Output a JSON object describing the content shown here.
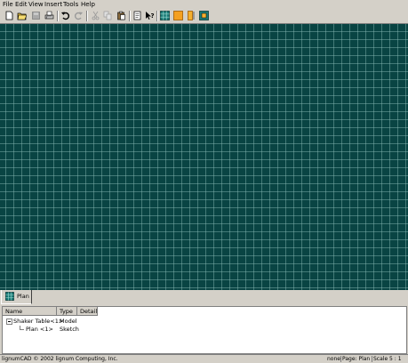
{
  "menubar": {
    "items": [
      "File",
      "Edit",
      "View",
      "Insert",
      "Tools",
      "Help"
    ]
  },
  "toolbar": {
    "icons": [
      "new-file-icon",
      "open-folder-icon",
      "save-icon",
      "print-icon",
      "undo-icon",
      "redo-icon",
      "cut-icon",
      "copy-icon",
      "paste-icon",
      "page-icon",
      "whats-this-icon",
      "grid-icon",
      "orange-square-icon",
      "column-icon",
      "view-icon"
    ]
  },
  "tabs": {
    "active_label": "Plan"
  },
  "tree": {
    "headers": [
      "Name",
      "Type",
      "Detail"
    ],
    "rows": [
      {
        "name": "Shaker Table<1>",
        "type": "Model"
      },
      {
        "name": "Plan <1>",
        "type": "Sketch"
      }
    ]
  },
  "status": {
    "left": "lignumCAD © 2002 lignum Computing, Inc.",
    "none": "none",
    "page": "Page: Plan",
    "scale": "Scale 5 : 1"
  },
  "colors": {
    "canvas": "#094443",
    "grid": "#4e8480",
    "chrome": "#d4d0c8"
  }
}
